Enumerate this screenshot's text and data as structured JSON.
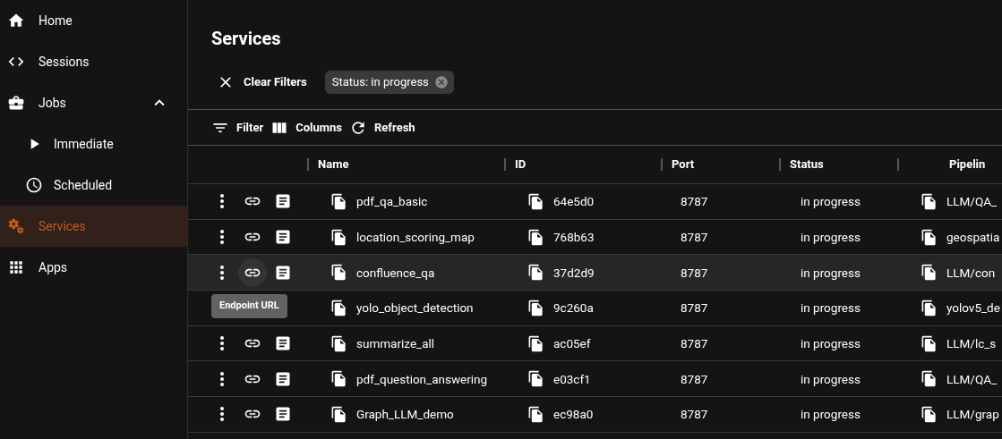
{
  "sidebar": {
    "items": [
      {
        "kind": "home",
        "label": "Home",
        "selected": false
      },
      {
        "kind": "sessions",
        "label": "Sessions",
        "selected": false
      },
      {
        "kind": "jobs",
        "label": "Jobs",
        "selected": false,
        "expanded": true,
        "children": [
          {
            "kind": "immediate",
            "label": "Immediate",
            "selected": false
          },
          {
            "kind": "scheduled",
            "label": "Scheduled",
            "selected": false
          }
        ]
      },
      {
        "kind": "services",
        "label": "Services",
        "selected": true
      },
      {
        "kind": "apps",
        "label": "Apps",
        "selected": false
      }
    ]
  },
  "page": {
    "title": "Services"
  },
  "filters": {
    "clear_label": "Clear Filters",
    "chips": [
      "Status: in progress"
    ]
  },
  "toolbar": [
    {
      "kind": "filter",
      "label": "Filter"
    },
    {
      "kind": "columns",
      "label": "Columns"
    },
    {
      "kind": "refresh",
      "label": "Refresh"
    }
  ],
  "table": {
    "columns": [
      "Name",
      "ID",
      "Port",
      "Status",
      "Pipelin"
    ],
    "rows": [
      {
        "name": "pdf_qa_basic",
        "id": "64e5d0",
        "port": "8787",
        "status": "in progress",
        "pipeline": "LLM/QA_",
        "highlighted": false
      },
      {
        "name": "location_scoring_map",
        "id": "768b63",
        "port": "8787",
        "status": "in progress",
        "pipeline": "geospatia",
        "highlighted": false
      },
      {
        "name": "confluence_qa",
        "id": "37d2d9",
        "port": "8787",
        "status": "in progress",
        "pipeline": "LLM/con",
        "highlighted": true,
        "tooltip": "Endpoint URL"
      },
      {
        "name": "yolo_object_detection",
        "id": "9c260a",
        "port": "8787",
        "status": "in progress",
        "pipeline": "yolov5_de",
        "highlighted": false
      },
      {
        "name": "summarize_all",
        "id": "ac05ef",
        "port": "8787",
        "status": "in progress",
        "pipeline": "LLM/lc_s",
        "highlighted": false
      },
      {
        "name": "pdf_question_answering",
        "id": "e03cf1",
        "port": "8787",
        "status": "in progress",
        "pipeline": "LLM/QA_",
        "highlighted": false
      },
      {
        "name": "Graph_LLM_demo",
        "id": "ec98a0",
        "port": "8787",
        "status": "in progress",
        "pipeline": "LLM/grap",
        "highlighted": false
      }
    ]
  }
}
